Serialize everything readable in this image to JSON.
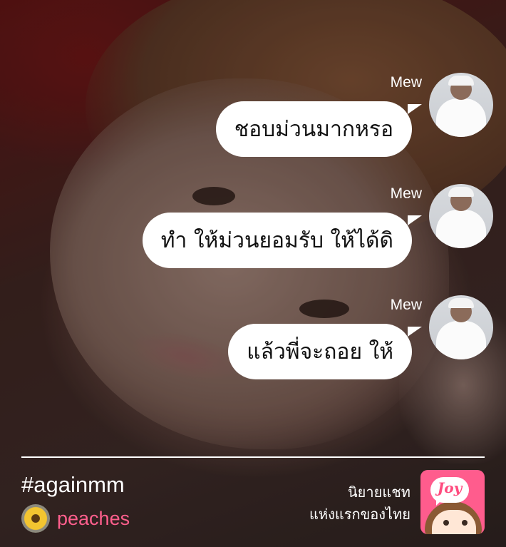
{
  "messages": [
    {
      "sender": "Mew",
      "text": "ชอบม่วนมากหรอ"
    },
    {
      "sender": "Mew",
      "text": "ทำ ให้ม่วนยอมรับ ให้ได้ดิ"
    },
    {
      "sender": "Mew",
      "text": "แล้วพี่จะถอย ให้"
    }
  ],
  "footer": {
    "hashtag": "#againmm",
    "username": "peaches",
    "promo_line1": "นิยายแชท",
    "promo_line2": "แห่งแรกของไทย",
    "app_brand": "Joy"
  },
  "icons": {
    "avatar": "profile-photo-icon",
    "user_avatar": "sunflower-icon",
    "app_icon": "joy-app-icon"
  },
  "colors": {
    "bubble": "#ffffff",
    "username": "#ff5f8d",
    "app_icon_bg": "#ff5c8d"
  }
}
